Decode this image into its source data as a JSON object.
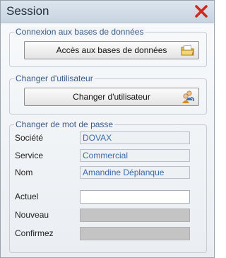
{
  "window": {
    "title": "Session"
  },
  "databases": {
    "group_label": "Connexion aux bases de données",
    "button_label": "Accès aux bases de données"
  },
  "user": {
    "group_label": "Changer d'utilisateur",
    "button_label": "Changer d'utilisateur"
  },
  "password": {
    "group_label": "Changer de mot de passe",
    "company_label": "Société",
    "company_value": "DOVAX",
    "service_label": "Service",
    "service_value": "Commercial",
    "name_label": "Nom",
    "name_value": "Amandine Déplanque",
    "current_label": "Actuel",
    "current_value": "",
    "new_label": "Nouveau",
    "new_value": "",
    "confirm_label": "Confirmez",
    "confirm_value": ""
  },
  "colors": {
    "accent": "#3a5b86",
    "close": "#d1281f"
  },
  "icons": {
    "close": "close-icon",
    "database": "folder-icon",
    "user": "users-icon"
  }
}
